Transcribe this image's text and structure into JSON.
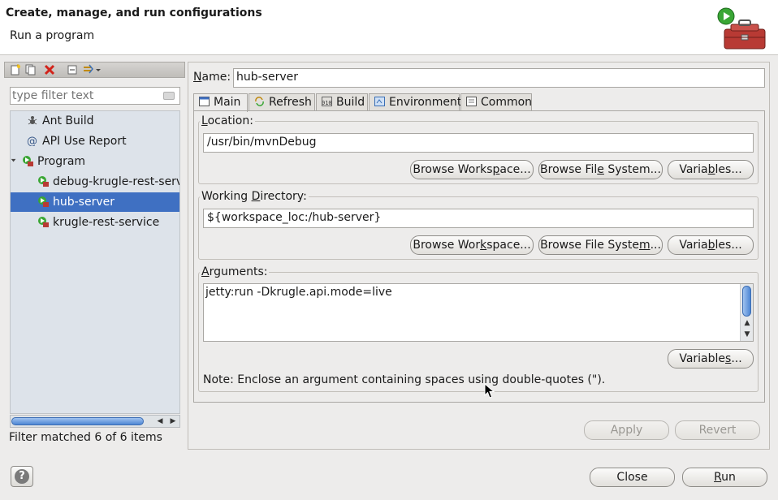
{
  "header": {
    "title": "Create, manage, and run configurations",
    "subtitle": "Run a program"
  },
  "left": {
    "filter_placeholder": "type filter text",
    "tree": [
      {
        "label": "Ant Build"
      },
      {
        "label": "API Use Report"
      },
      {
        "label": "Program"
      },
      {
        "label": "debug-krugle-rest-servi"
      },
      {
        "label": "hub-server"
      },
      {
        "label": "krugle-rest-service"
      }
    ],
    "status": "Filter matched 6 of 6 items"
  },
  "right": {
    "name_label_prefix": "",
    "name_label_mnemonic": "N",
    "name_label_rest": "ame:",
    "name_value": "hub-server",
    "tabs": [
      {
        "label": "Main"
      },
      {
        "label": "Refresh"
      },
      {
        "label": "Build"
      },
      {
        "label": "Environment"
      },
      {
        "label": "Common"
      }
    ],
    "location": {
      "label_prefix": "",
      "label_mnemonic": "L",
      "label_rest": "ocation:",
      "value": "/usr/bin/mvnDebug"
    },
    "working_dir": {
      "label_prefix": "Working ",
      "label_mnemonic": "D",
      "label_rest": "irectory:",
      "value": "${workspace_loc:/hub-server}"
    },
    "arguments": {
      "label_prefix": "",
      "label_mnemonic": "A",
      "label_rest": "rguments:",
      "value": "jetty:run -Dkrugle.api.mode=live"
    },
    "buttons": {
      "browse_workspace_1": {
        "prefix": "Browse Works",
        "mnemonic": "p",
        "rest": "ace..."
      },
      "browse_fs_1": {
        "prefix": "Browse Fil",
        "mnemonic": "e",
        "rest": " System..."
      },
      "variables_1": {
        "prefix": "Varia",
        "mnemonic": "b",
        "rest": "les..."
      },
      "browse_workspace_2": {
        "prefix": "Browse Wor",
        "mnemonic": "k",
        "rest": "space..."
      },
      "browse_fs_2": {
        "prefix": "Browse File Syste",
        "mnemonic": "m",
        "rest": "..."
      },
      "variables_2": {
        "prefix": "Varia",
        "mnemonic": "b",
        "rest": "les..."
      },
      "variables_3": {
        "prefix": "Variable",
        "mnemonic": "s",
        "rest": "..."
      },
      "apply": "Apply",
      "revert": "Revert"
    },
    "note": "Note: Enclose an argument containing spaces using double-quotes (\")."
  },
  "footer": {
    "help": "?",
    "close": "Close",
    "run_mnemonic": "R",
    "run_rest": "un"
  },
  "colors": {
    "selection": "#3f70c2",
    "tree_bg": "#dde3ea",
    "window_bg": "#edeceb"
  }
}
